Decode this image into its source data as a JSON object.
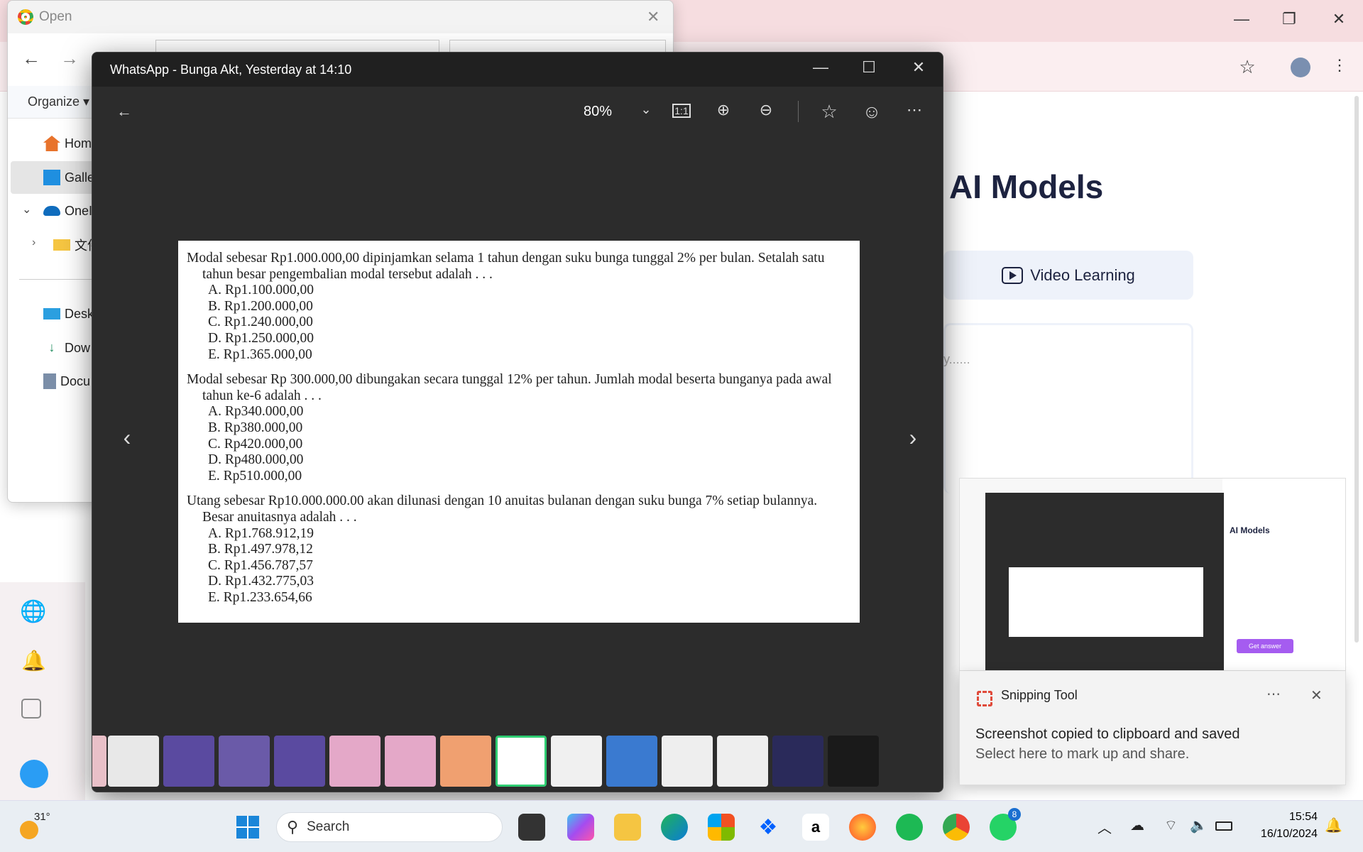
{
  "chrome": {
    "heading": "AI Models",
    "video_button": "Video Learning",
    "textbox_placeholder": "y......",
    "accent": "#1d2340"
  },
  "explorer": {
    "title": "Open",
    "organize": "Organize",
    "sidebar": [
      {
        "label": "Hom",
        "icon": "home-icon"
      },
      {
        "label": "Galle",
        "icon": "gallery-icon"
      },
      {
        "label": "OneI",
        "icon": "cloud-icon"
      },
      {
        "label": "文件",
        "icon": "folder-icon"
      },
      {
        "label": "Desk",
        "icon": "desktop-icon"
      },
      {
        "label": "Dow",
        "icon": "download-icon"
      },
      {
        "label": "Docu",
        "icon": "documents-icon"
      }
    ]
  },
  "viewer": {
    "title": "WhatsApp - Bunga Akt, Yesterday at 14:10",
    "zoom": "80%",
    "questions": [
      {
        "stem": "Modal sebesar Rp1.000.000,00 dipinjamkan selama 1 tahun dengan suku bunga tunggal 2% per bulan. Setalah satu tahun besar pengembalian modal tersebut adalah . . .",
        "options": [
          "A.  Rp1.100.000,00",
          "B.  Rp1.200.000,00",
          "C.  Rp1.240.000,00",
          "D.  Rp1.250.000,00",
          "E.  Rp1.365.000,00"
        ]
      },
      {
        "stem": "Modal sebesar Rp 300.000,00 dibungakan secara tunggal 12% per tahun. Jumlah modal beserta bunganya pada awal tahun ke-6 adalah  . . .",
        "options": [
          "A.  Rp340.000,00",
          "B.  Rp380.000,00",
          "C.  Rp420.000,00",
          "D.  Rp480.000,00",
          "E.  Rp510.000,00"
        ]
      },
      {
        "stem": "Utang sebesar Rp10.000.000.00 akan dilunasi dengan 10 anuitas bulanan dengan suku bunga 7% setiap bulannya. Besar anuitasnya adalah . . .",
        "options": [
          "A.  Rp1.768.912,19",
          "B.  Rp1.497.978,12",
          "C.  Rp1.456.787,57",
          "D.  Rp1.432.775,03",
          "E.  Rp1.233.654,66"
        ]
      }
    ],
    "film_selected_index": 7
  },
  "snipping": {
    "app": "Snipping Tool",
    "line1": "Screenshot copied to clipboard and saved",
    "line2": "Select here to mark up and share.",
    "preview_heading": "AI Models",
    "preview_button": "Get answer"
  },
  "taskbar": {
    "weather": "31°",
    "search": "Search",
    "whatsapp_badge": "8",
    "time": "15:54",
    "date": "16/10/2024"
  }
}
